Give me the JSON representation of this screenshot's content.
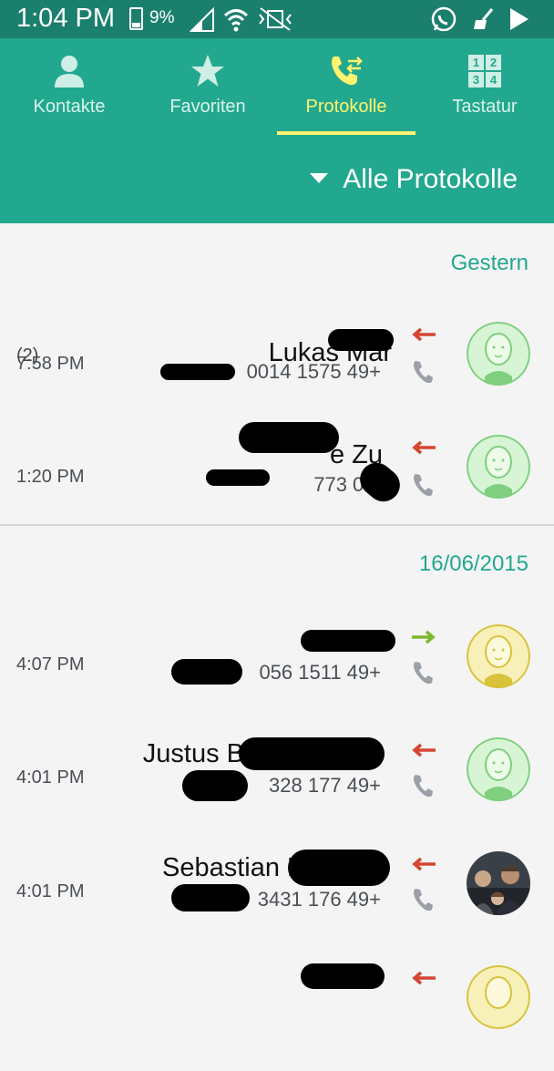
{
  "status_bar": {
    "time": "1:04 PM",
    "battery": "9%"
  },
  "tabs": [
    {
      "label": "Kontakte",
      "icon": "person-icon"
    },
    {
      "label": "Favoriten",
      "icon": "star-icon"
    },
    {
      "label": "Protokolle",
      "icon": "call-log-icon"
    },
    {
      "label": "Tastatur",
      "icon": "dialpad-icon"
    }
  ],
  "filter_label": "Alle Protokolle",
  "sections": [
    {
      "header": "Gestern"
    },
    {
      "header": "16/06/2015"
    }
  ],
  "calls": [
    {
      "count": "(2)",
      "name": "Lukas Mar",
      "number": "0014 1575 49+",
      "time": "7:58 PM",
      "direction": "missed",
      "avatar": "green"
    },
    {
      "count": "",
      "name": "e Zu",
      "number": "773 0433",
      "time": "1:20 PM",
      "direction": "missed",
      "avatar": "green"
    },
    {
      "count": "",
      "name": "",
      "number": "056 1511 49+",
      "time": "4:07 PM",
      "direction": "outgoing",
      "avatar": "yellow"
    },
    {
      "count": "",
      "name": "Justus B",
      "number": "328 177 49+",
      "time": "4:01 PM",
      "direction": "missed",
      "avatar": "green"
    },
    {
      "count": "",
      "name": "Sebastian D",
      "number": "3431 176 49+",
      "time": "4:01 PM",
      "direction": "missed",
      "avatar": "photo"
    }
  ],
  "colors": {
    "missed": "#d64532",
    "outgoing": "#7cb82f",
    "accent": "#22a88f",
    "active_tab": "#fff36f"
  }
}
